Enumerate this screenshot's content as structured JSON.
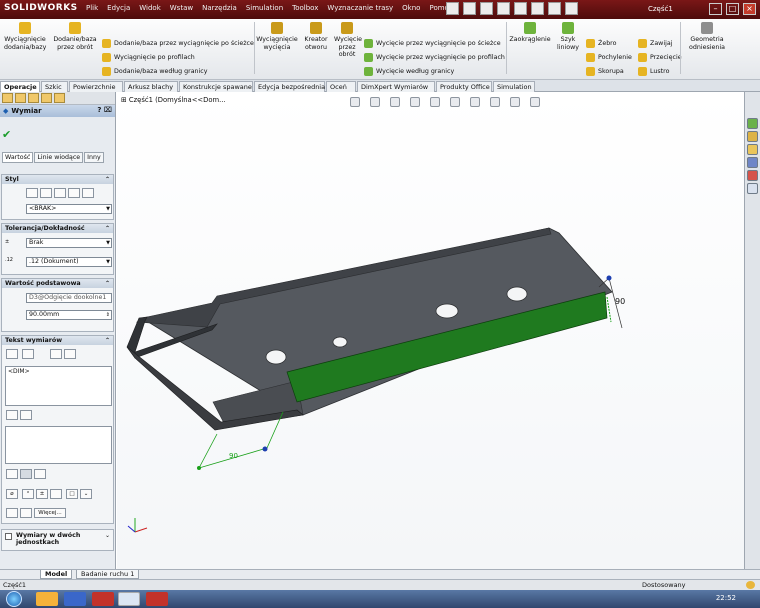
{
  "titlebar": {
    "logo": "SOLIDWORKS",
    "menus": [
      "Plik",
      "Edycja",
      "Widok",
      "Wstaw",
      "Narzędzia",
      "Simulation",
      "Toolbox",
      "Wyznaczanie trasy",
      "Okno",
      "Pomoc"
    ],
    "doc_title": "Część1",
    "min": "–",
    "max": "□",
    "close": "×"
  },
  "command_manager": {
    "big_buttons": [
      "Wyciągnięcie dodania/bazy",
      "Dodanie/baza przez obrót",
      "Wyciągnięcie wycięcia",
      "Kreator otworu",
      "Wycięcie przez obrót",
      "Zaokrąglenie",
      "Szyk liniowy",
      "Geometria odniesienia"
    ],
    "small_col1": [
      "Dodanie/baza przez wyciągnięcie po ścieżce",
      "Wyciągnięcie po profilach",
      "Dodanie/baza według granicy"
    ],
    "small_col2": [
      "Wycięcie przez wyciągnięcie po ścieżce",
      "Wycięcie przez wyciągnięcie po profilach",
      "Wycięcie według granicy"
    ],
    "small_col3": [
      "Żebro",
      "Pochylenie",
      "Skorupa"
    ],
    "small_col4": [
      "Zawijaj",
      "Przecięcie",
      "Lustro"
    ]
  },
  "tabs": [
    "Operacje",
    "Szkic",
    "Powierzchnie",
    "Arkusz blachy",
    "Konstrukcje spawane",
    "Edycja bezpośrednia",
    "Oceń",
    "DimXpert Wymiarów",
    "Produkty Office",
    "Simulation"
  ],
  "panel": {
    "title": "Wymiar",
    "subtabs": [
      "Wartość",
      "Linie wiodące",
      "Inny"
    ],
    "styl": {
      "header": "Styl",
      "select": "<BRAK>"
    },
    "tolerance": {
      "header": "Tolerancja/Dokładność",
      "tol": "Brak",
      "precision": ".12 (Dokument)"
    },
    "primary": {
      "header": "Wartość podstawowa",
      "name": "D3@Odgięcie dookolne1",
      "value": "90.00mm"
    },
    "text": {
      "header": "Tekst wymiarów",
      "dim": "<DIM>",
      "more": "Więcej..."
    },
    "dual": {
      "header": "Wymiary w dwóch jednostkach"
    }
  },
  "viewport": {
    "tree_label": "Część1 (Domyślna<<Dom...",
    "dimension_value": "90"
  },
  "bottom_tabs": [
    "Model",
    "Badanie ruchu 1"
  ],
  "status": {
    "left": "Część1",
    "units": "Dostosowany"
  },
  "taskbar": {
    "clock": "22:52"
  },
  "colors": {
    "titlebar": "#6b1212",
    "part_dark": "#4a4d52",
    "part_face": "#5c6066",
    "selected_face": "#1f7a1f",
    "sketch": "#1aa01a"
  }
}
